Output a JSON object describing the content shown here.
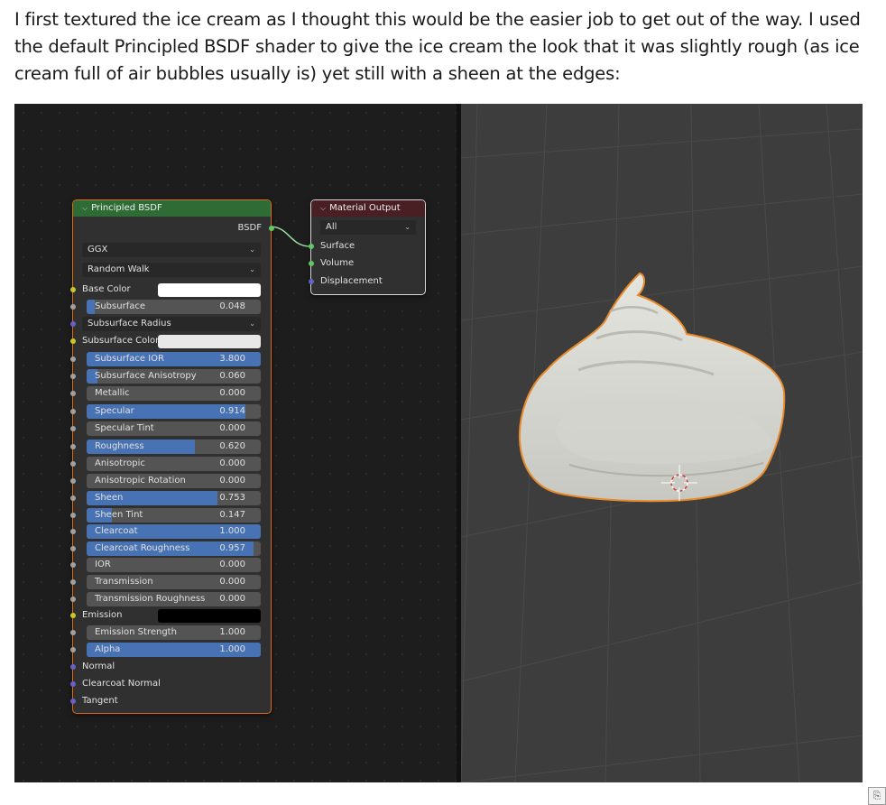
{
  "intro_text": "I first textured the ice cream as I thought this would be the easier job to get out of the way. I used the default Principled BSDF shader to give the ice cream the look that it was slightly rough (as ice cream full of air bubbles usually is) yet still with a sheen at the edges:",
  "bsdf_node": {
    "title": "Principled BSDF",
    "output_label": "BSDF",
    "distribution": "GGX",
    "subsurface_method": "Random Walk",
    "base_color": {
      "label": "Base Color",
      "color": "#ffffff"
    },
    "subsurface": {
      "label": "Subsurface",
      "value": "0.048",
      "fraction": 0.048
    },
    "subsurface_radius": "Subsurface Radius",
    "subsurface_color": {
      "label": "Subsurface Color",
      "color": "#e8e8e8"
    },
    "subsurface_ior": {
      "label": "Subsurface IOR",
      "value": "3.800",
      "fraction": 1.0
    },
    "subsurface_anisotropy": {
      "label": "Subsurface Anisotropy",
      "value": "0.060",
      "fraction": 0.06
    },
    "metallic": {
      "label": "Metallic",
      "value": "0.000",
      "fraction": 0.0
    },
    "specular": {
      "label": "Specular",
      "value": "0.914",
      "fraction": 0.914
    },
    "specular_tint": {
      "label": "Specular Tint",
      "value": "0.000",
      "fraction": 0.0
    },
    "roughness": {
      "label": "Roughness",
      "value": "0.620",
      "fraction": 0.62
    },
    "anisotropic": {
      "label": "Anisotropic",
      "value": "0.000",
      "fraction": 0.0
    },
    "anisotropic_rotation": {
      "label": "Anisotropic Rotation",
      "value": "0.000",
      "fraction": 0.0
    },
    "sheen": {
      "label": "Sheen",
      "value": "0.753",
      "fraction": 0.753
    },
    "sheen_tint": {
      "label": "Sheen Tint",
      "value": "0.147",
      "fraction": 0.147
    },
    "clearcoat": {
      "label": "Clearcoat",
      "value": "1.000",
      "fraction": 1.0
    },
    "clearcoat_roughness": {
      "label": "Clearcoat Roughness",
      "value": "0.957",
      "fraction": 0.957
    },
    "ior": {
      "label": "IOR",
      "value": "0.000",
      "fraction": 0.0
    },
    "transmission": {
      "label": "Transmission",
      "value": "0.000",
      "fraction": 0.0
    },
    "transmission_roughness": {
      "label": "Transmission Roughness",
      "value": "0.000",
      "fraction": 0.0
    },
    "emission": {
      "label": "Emission",
      "color": "#000000"
    },
    "emission_strength": {
      "label": "Emission Strength",
      "value": "1.000",
      "fraction": 0.0
    },
    "alpha": {
      "label": "Alpha",
      "value": "1.000",
      "fraction": 1.0
    },
    "normal": "Normal",
    "clearcoat_normal": "Clearcoat Normal",
    "tangent": "Tangent"
  },
  "output_node": {
    "title": "Material Output",
    "target": "All",
    "inputs": [
      "Surface",
      "Volume",
      "Displacement"
    ]
  },
  "colors": {
    "slider_fill": "#4772b3",
    "active_outline": "#e78a2a",
    "ice_cream": "#dcddd6",
    "bsdf_header": "#2f6b34",
    "output_header": "#4a1f24"
  },
  "icons": [
    "chevron-down-icon",
    "dropdown-arrow-icon",
    "3d-cursor-icon",
    "paste-options-icon"
  ]
}
